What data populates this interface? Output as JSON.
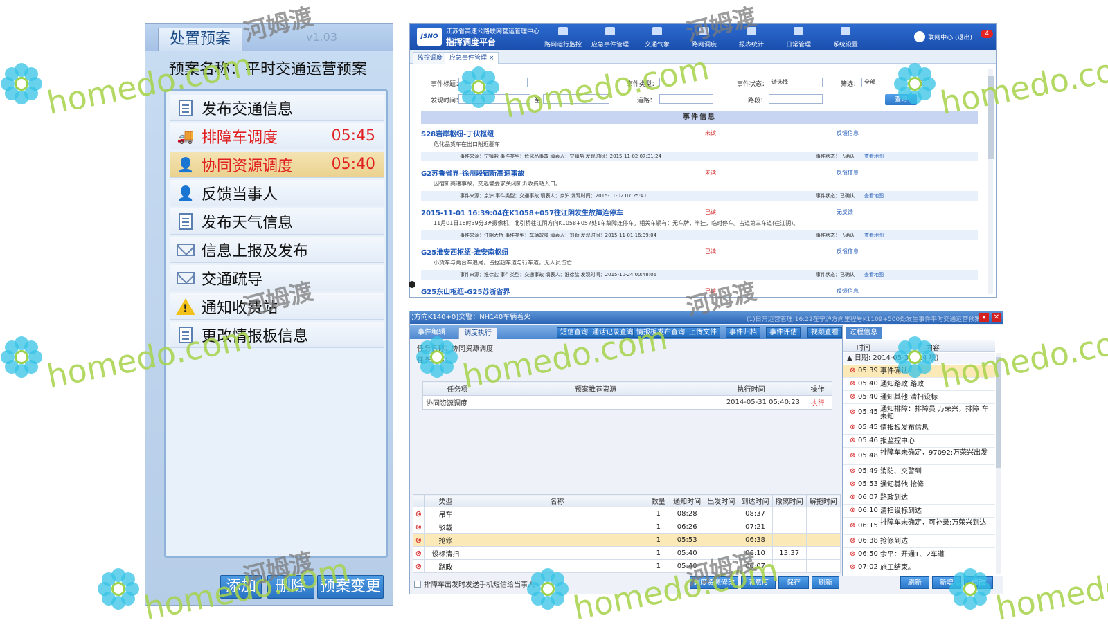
{
  "left_panel": {
    "tab": "处置预案",
    "version": "v1.03",
    "plan_name": "预案名称：平时交通运营预案",
    "items": [
      {
        "label": "发布交通信息",
        "time": "",
        "icon": "document-icon",
        "state": "normal"
      },
      {
        "label": "排障车调度",
        "time": "05:45",
        "icon": "tow-truck-icon",
        "state": "red"
      },
      {
        "label": "协同资源调度",
        "time": "05:40",
        "icon": "person-computer-icon",
        "state": "red-highlight"
      },
      {
        "label": "反馈当事人",
        "time": "",
        "icon": "person-computer-icon",
        "state": "normal"
      },
      {
        "label": "发布天气信息",
        "time": "",
        "icon": "document-icon",
        "state": "normal"
      },
      {
        "label": "信息上报及发布",
        "time": "",
        "icon": "mail-icon",
        "state": "normal"
      },
      {
        "label": "交通疏导",
        "time": "",
        "icon": "mail-icon",
        "state": "normal"
      },
      {
        "label": "通知收费站",
        "time": "",
        "icon": "warning-icon",
        "state": "normal"
      },
      {
        "label": "更改情报板信息",
        "time": "",
        "icon": "document-icon",
        "state": "normal"
      }
    ],
    "buttons": {
      "add": "添加",
      "delete": "删除",
      "change": "预案变更"
    }
  },
  "top_window": {
    "org": "江苏省高速公路联网营运管理中心",
    "title": "指挥调度平台",
    "logo": "JSNO",
    "nav": [
      "路网运行监控",
      "应急事件管理",
      "交通气象",
      "路网调度",
      "报表统计",
      "日常管理",
      "系统设置"
    ],
    "user": "联网中心 (退出)",
    "badge": "4",
    "tabs": [
      "监控调度",
      "应急事件管理 ×"
    ],
    "filters": {
      "event_name": "事件标题：",
      "event_type": "事件类型：",
      "event_status": "事件状态：",
      "status_value": "请选择",
      "screen": "筛选：",
      "screen_value": "全部",
      "source": "来源：",
      "time": "发现时间：",
      "to": "至",
      "road": "道路：",
      "section": "路段：",
      "query": "查询"
    },
    "table_head": "事件信息",
    "events": [
      {
        "title": "S28岩岸枢纽-丁伙枢纽",
        "status": "未读",
        "feedback": "反馈信息",
        "desc": "危化品货车在出口附近翻车",
        "meta": "事件来源：宁镇盐   事件类型：危化品事故   填表人：宁镇盐   发现时间：2015-11-02 07:31:24",
        "state": "事件状态：已确认",
        "map": "查看地图"
      },
      {
        "title": "G2苏鲁省界-徐州段宿新高速事故",
        "status": "未读",
        "feedback": "反馈信息",
        "desc": "因宿新高速事故，交巡警要求关闭新沂收费站入口。",
        "meta": "事件来源：京沪   事件类型：交通事故   填表人：京沪   发现时间：2015-11-02 07:25:41",
        "state": "事件状态：已确认",
        "map": "查看地图"
      },
      {
        "title": "2015-11-01 16:39:04在K1058+057往江阴发生故障连停车",
        "status": "已读",
        "feedback": "无反馈",
        "desc": "11月01日16时39分3#摄像机，北引桥往江阴方向K1058+057处1车故障连停车。相关车辆有：无车牌，半挂，临时停车。占道第三车道(往江阴)。",
        "meta": "事件来源：江阴大桥   事件类型：车辆故障   填表人：刘勤   发现时间：2015-11-01 16:39:04",
        "state": "事件状态：已确认",
        "map": "查看地图"
      },
      {
        "title": "G25淮安西枢纽-淮安南枢纽",
        "status": "已读",
        "feedback": "反馈信息",
        "desc": "小货车与两台车追尾，占据超车道与行车道，无人员伤亡",
        "meta": "事件来源：淮徐盐   事件类型：交通事故   填表人：淮徐盐   发现时间：2015-10-24 00:48:06",
        "state": "事件状态：已确认",
        "map": "查看地图"
      },
      {
        "title": "G25东山枢纽-G25苏浙省界",
        "status": "已读",
        "feedback": "反馈信息",
        "desc": "",
        "meta": "",
        "state": "",
        "map": ""
      }
    ]
  },
  "bottom_window": {
    "title": ")方向K140+0]交警：NH140车辆着火",
    "notice": "(1)日常运营管理:16:22在宁沪方向里程号K1109+500处发生事件平时交通运营预案(1",
    "tabs": [
      "事件编辑",
      "调度执行"
    ],
    "tools": [
      "短信查询",
      "通话记录查询",
      "情报板发布查询",
      "上传文件",
      "事件归档",
      "事件评估",
      "视频查看"
    ],
    "task_name_label": "任务名称：",
    "task_name_value": "协同资源调度",
    "task_desc_label": "任务描述：",
    "task_table": {
      "headers": [
        "任务项",
        "预案推荐资源",
        "执行时间",
        "操作"
      ],
      "rows": [
        [
          "协同资源调度",
          "",
          "2014-05-31 05:40:23",
          "执行"
        ]
      ]
    },
    "res_table": {
      "headers": [
        "",
        "类型",
        "名称",
        "数量",
        "通知时间",
        "出发时间",
        "到达时间",
        "撤离时间",
        "解拖时间"
      ],
      "rows": [
        [
          "⊗",
          "吊车",
          "",
          "1",
          "08:28",
          "",
          "08:37",
          "",
          ""
        ],
        [
          "⊗",
          "驳载",
          "",
          "1",
          "06:26",
          "",
          "07:21",
          "",
          ""
        ],
        [
          "⊗",
          "抢修",
          "",
          "1",
          "05:53",
          "",
          "06:38",
          "",
          ""
        ],
        [
          "⊗",
          "设标清扫",
          "",
          "1",
          "05:40",
          "",
          "06:10",
          "13:37",
          ""
        ],
        [
          "⊗",
          "路政",
          "",
          "1",
          "05:40",
          "",
          "06:07",
          "",
          ""
        ]
      ]
    },
    "checkbox_label": "排障车出发时发送手机短信给当事人",
    "buttons": [
      "调度资源修改",
      "满意度",
      "保存",
      "刷新"
    ],
    "log": {
      "tab": "过程信息",
      "headers": [
        "时间",
        "内容"
      ],
      "date": "▲ 日期: 2014-05-31 (24 项)",
      "rows": [
        {
          "t": "05:39",
          "c": "事件确认"
        },
        {
          "t": "05:40",
          "c": "通知路政 路政"
        },
        {
          "t": "05:40",
          "c": "通知其他 清扫设标"
        },
        {
          "t": "05:45",
          "c": "通知排障：排障员 万荣兴，排障 车 未知"
        },
        {
          "t": "05:45",
          "c": "情报板发布信息"
        },
        {
          "t": "05:46",
          "c": "报监控中心"
        },
        {
          "t": "05:48",
          "c": "排障车未确定，97092:万荣兴出发"
        },
        {
          "t": "05:49",
          "c": "消防、交警到"
        },
        {
          "t": "05:53",
          "c": "通知其他 抢修"
        },
        {
          "t": "06:07",
          "c": "路政到达"
        },
        {
          "t": "06:10",
          "c": "清扫设标到达"
        },
        {
          "t": "06:15",
          "c": "排障车未确定，可补录:万荣兴到达"
        },
        {
          "t": "06:38",
          "c": "抢修到达"
        },
        {
          "t": "06:50",
          "c": "余平：开通1、2车道"
        },
        {
          "t": "07:02",
          "c": "施工结束。"
        }
      ],
      "buttons": [
        "刷新",
        "新增",
        "修改"
      ]
    }
  },
  "watermark": {
    "site": "homedo.com",
    "cn": "河姆渡"
  }
}
